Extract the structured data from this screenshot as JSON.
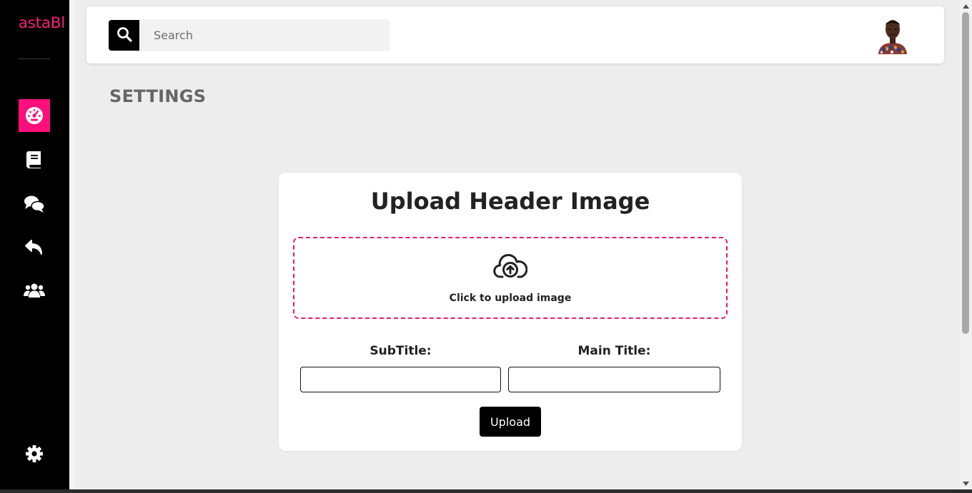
{
  "brand": {
    "name": "astaBl",
    "color": "#ff1f7a"
  },
  "sidebar": {
    "items": [
      {
        "name": "dashboard",
        "icon": "speedometer-icon",
        "active": true
      },
      {
        "name": "posts",
        "icon": "book-icon",
        "active": false
      },
      {
        "name": "comments",
        "icon": "chat-bubbles-icon",
        "active": false
      },
      {
        "name": "replies",
        "icon": "reply-arrow-icon",
        "active": false
      },
      {
        "name": "users",
        "icon": "users-icon",
        "active": false
      }
    ],
    "bottom_item": {
      "name": "settings",
      "icon": "gear-icon"
    },
    "active_color": "#ff0f7b"
  },
  "header": {
    "search": {
      "placeholder": "Search",
      "value": "",
      "icon": "search-icon"
    },
    "avatar": {
      "icon": "user-avatar"
    }
  },
  "page": {
    "title": "SETTINGS"
  },
  "upload_form": {
    "title": "Upload Header Image",
    "dropzone": {
      "icon": "cloud-upload-icon",
      "text": "Click to upload image",
      "border_color": "#e8196e"
    },
    "subtitle_label": "SubTitle:",
    "subtitle_value": "",
    "main_title_label": "Main Title:",
    "main_title_value": "",
    "submit_label": "Upload"
  }
}
